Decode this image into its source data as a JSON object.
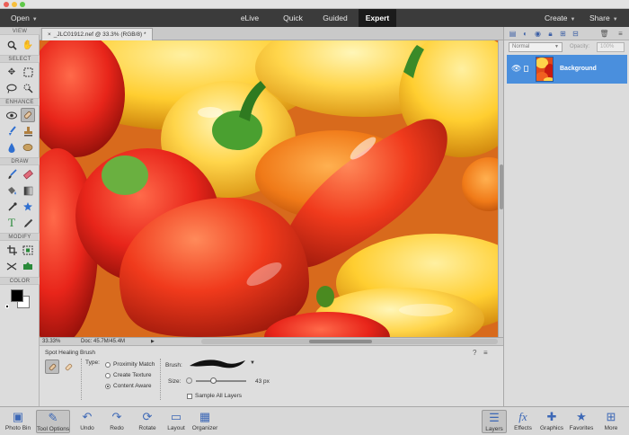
{
  "topbar": {
    "open_label": "Open",
    "modes": [
      "eLive",
      "Quick",
      "Guided",
      "Expert"
    ],
    "active_mode": "Expert",
    "create_label": "Create",
    "share_label": "Share"
  },
  "toolbox": {
    "sections": [
      "VIEW",
      "SELECT",
      "ENHANCE",
      "DRAW",
      "MODIFY",
      "COLOR"
    ],
    "tools": {
      "view": [
        "zoom-icon",
        "hand-icon"
      ],
      "select": [
        "move-icon",
        "marquee-icon",
        "lasso-icon",
        "quick-selection-icon"
      ],
      "enhance": [
        "red-eye-icon",
        "spot-healing-brush-icon",
        "smart-brush-icon",
        "clone-stamp-icon",
        "blur-icon",
        "sponge-icon"
      ],
      "draw": [
        "brush-icon",
        "eraser-icon",
        "paint-bucket-icon",
        "gradient-icon",
        "eyedropper-icon",
        "custom-shape-icon",
        "type-icon",
        "pencil-icon"
      ],
      "modify": [
        "crop-icon",
        "recompose-icon",
        "straighten-icon",
        "content-aware-move-icon"
      ]
    },
    "foreground_color": "#000000",
    "background_color": "#ffffff"
  },
  "document": {
    "tab_label": "_JLC01912.nef @ 33.3% (RGB/8) *",
    "zoom": "33.33%",
    "doc_size": "Doc: 45.7M/45.4M"
  },
  "tool_options": {
    "tool_name": "Spot Healing Brush",
    "type_label": "Type:",
    "types": [
      "Proximity Match",
      "Create Texture",
      "Content Aware"
    ],
    "selected_type": "Content Aware",
    "brush_label": "Brush:",
    "size_label": "Size:",
    "size_value": "43 px",
    "size_fraction": 0.35,
    "sample_all_layers_label": "Sample All Layers",
    "sample_all_layers": false
  },
  "layers_panel": {
    "blend_mode": "Normal",
    "opacity_label": "Opacity:",
    "opacity_value": "100%",
    "layers": [
      {
        "name": "Background",
        "visible": true,
        "selected": true
      }
    ]
  },
  "bottom_bar": {
    "left": [
      {
        "label": "Photo Bin",
        "icon": "photo-bin-icon"
      },
      {
        "label": "Tool Options",
        "icon": "tool-options-icon",
        "active": true
      },
      {
        "label": "Undo",
        "icon": "undo-icon"
      },
      {
        "label": "Redo",
        "icon": "redo-icon"
      },
      {
        "label": "Rotate",
        "icon": "rotate-icon"
      },
      {
        "label": "Layout",
        "icon": "layout-icon"
      },
      {
        "label": "Organizer",
        "icon": "organizer-icon"
      }
    ],
    "right": [
      {
        "label": "Layers",
        "icon": "layers-icon",
        "active": true
      },
      {
        "label": "Effects",
        "icon": "effects-icon"
      },
      {
        "label": "Graphics",
        "icon": "graphics-icon"
      },
      {
        "label": "Favorites",
        "icon": "favorites-icon"
      },
      {
        "label": "More",
        "icon": "more-icon"
      }
    ]
  }
}
